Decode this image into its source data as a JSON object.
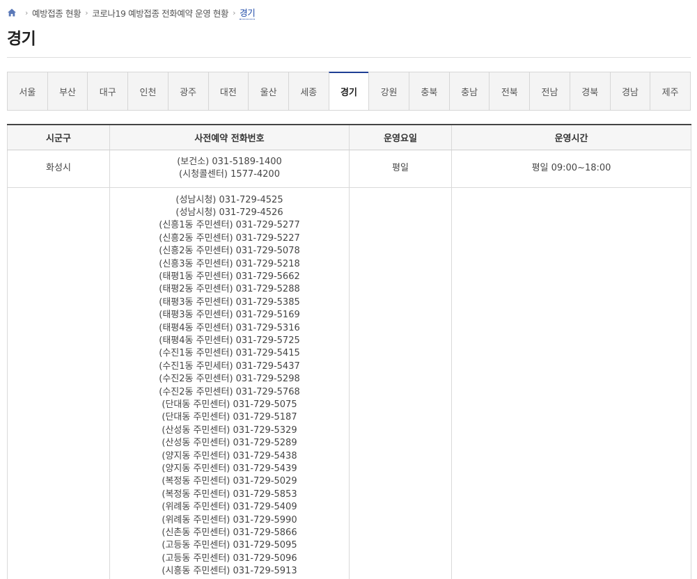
{
  "breadcrumb": {
    "items": [
      "예방접종 현황",
      "코로나19 예방접종 전화예약 운영 현황"
    ],
    "current": "경기"
  },
  "page": {
    "title": "경기"
  },
  "tabs": [
    "서울",
    "부산",
    "대구",
    "인천",
    "광주",
    "대전",
    "울산",
    "세종",
    "경기",
    "강원",
    "충북",
    "충남",
    "전북",
    "전남",
    "경북",
    "경남",
    "제주"
  ],
  "active_tab": "경기",
  "table": {
    "headers": [
      "시군구",
      "사전예약 전화번호",
      "운영요일",
      "운영시간"
    ],
    "rows": [
      {
        "district": "화성시",
        "phones": [
          "(보건소) 031-5189-1400",
          "(시청콜센터) 1577-4200"
        ],
        "days": "평일",
        "hours": "평일 09:00~18:00"
      },
      {
        "district": "",
        "phones": [
          "(성남시청) 031-729-4525",
          "(성남시청) 031-729-4526",
          "(신흥1동 주민센터) 031-729-5277",
          "(신흥2동 주민센터) 031-729-5227",
          "(신흥2동 주민센터) 031-729-5078",
          "(신흥3동 주민센터) 031-729-5218",
          "(태평1동 주민센터) 031-729-5662",
          "(태평2동 주민센터) 031-729-5288",
          "(태평3동 주민센터) 031-729-5385",
          "(태평3동 주민센터) 031-729-5169",
          "(태평4동 주민센터) 031-729-5316",
          "(태평4동 주민센터) 031-729-5725",
          "(수진1동 주민센터) 031-729-5415",
          "(수진1동 주민세터) 031-729-5437",
          "(수진2동 주민센터) 031-729-5298",
          "(수진2동 주민센터) 031-729-5768",
          "(단대동 주민센터) 031-729-5075",
          "(단대동 주민센터) 031-729-5187",
          "(산성동 주민센터) 031-729-5329",
          "(산성동 주민센터) 031-729-5289",
          "(양지동 주민센터) 031-729-5438",
          "(양지동 주민센터) 031-729-5439",
          "(복정동 주민센터) 031-729-5029",
          "(복정동 주민센터) 031-729-5853",
          "(위례동 주민센터) 031-729-5409",
          "(위례동 주민센터) 031-729-5990",
          "(신촌동 주민센터) 031-729-5866",
          "(고등동 주민센터) 031-729-5095",
          "(고등동 주민센터) 031-729-5096",
          "(시흥동 주민센터) 031-729-5913"
        ],
        "days": "",
        "hours": ""
      }
    ]
  },
  "colors": {
    "accent": "#1e3f94",
    "link": "#1e4aa8",
    "tab_bg": "#f4f4f4"
  }
}
